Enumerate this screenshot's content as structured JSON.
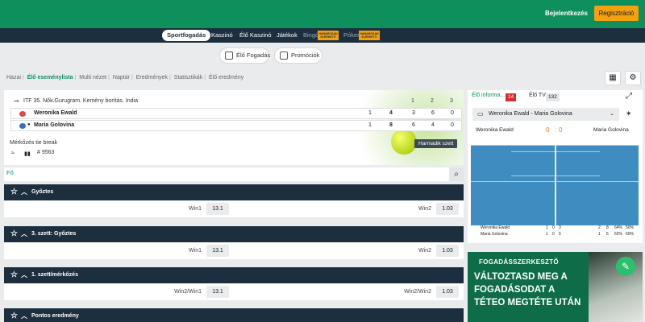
{
  "header": {
    "login_label": "Bejelentkezés",
    "register_label": "Regisztráció"
  },
  "nav": {
    "items": [
      "Sportfogadás",
      "Kaszinó",
      "Élő Kaszinó",
      "Játékok",
      "Bingó",
      "Póker"
    ],
    "badges": [
      "HAMAROSAN ELÉRHETŐ",
      "HAMAROSAN ELÉRHETŐ"
    ]
  },
  "subnav": {
    "live_label": "Élő Fogadás",
    "promo_label": "Promóciók"
  },
  "breadcrumb": [
    "Hazai",
    "Élő eseménylista",
    "Multi nézet",
    "Naptár",
    "Eredmények",
    "Statisztikák",
    "Élő eredmény"
  ],
  "scoreboard": {
    "tournament": "ITF 35. Nők.Gurugram. Kemény borítás. India",
    "set_headers": [
      "1",
      "2",
      "3"
    ],
    "players": [
      {
        "name": "Weronika Ewald",
        "points": "1",
        "games": "4",
        "sets": [
          "3",
          "6",
          "0"
        ]
      },
      {
        "name": "Maria Golovina",
        "points": "1",
        "games": "8",
        "sets": [
          "6",
          "4",
          "0"
        ]
      }
    ],
    "status": "Mérkőzés tie break",
    "match_id": "# 9563",
    "badge": "Harmadik szett"
  },
  "tabs": {
    "main": "Fő"
  },
  "markets": [
    {
      "title": "Győztes",
      "left_label": "Win1",
      "left_odd": "13.1",
      "right_label": "Win2",
      "right_odd": "1.03"
    },
    {
      "title": "3. szett: Győztes",
      "left_label": "Win1",
      "left_odd": "13.1",
      "right_label": "Win2",
      "right_odd": "1.03"
    },
    {
      "title": "1. szett/mérkőzés",
      "left_label": "Win2/Win1",
      "left_odd": "13.1",
      "right_label": "Win2/Win2",
      "right_odd": "1.03"
    },
    {
      "title": "Pontos eredmény"
    }
  ],
  "side": {
    "tab_info": "Élő informa...",
    "tab_info_count": "14",
    "tab_tv": "Élő TV",
    "tab_tv_count": "132",
    "match_select": "Weronika Ewald - Maria Golovina",
    "player_left": "Weronika Ewald",
    "player_right": "Maria Golovina",
    "score_left": "0",
    "score_right": "0",
    "mini_rows": [
      {
        "name": "Weronika Ewald",
        "s1": "1",
        "s2": "0",
        "s3": "3",
        "a": "2",
        "b": "8",
        "c": "64%",
        "d": "50%"
      },
      {
        "name": "Maria Golovina",
        "s1": "1",
        "s2": "0",
        "s3": "6",
        "a": "1",
        "b": "5",
        "c": "62%",
        "d": "60%"
      }
    ]
  },
  "ad": {
    "header": "FOGADÁSSZERKESZTŐ",
    "lines": [
      "VÁLTOZTASD MEG A",
      "FOGADÁSODAT A",
      "TÉTEO MEGTÉTE UTÁN"
    ]
  }
}
